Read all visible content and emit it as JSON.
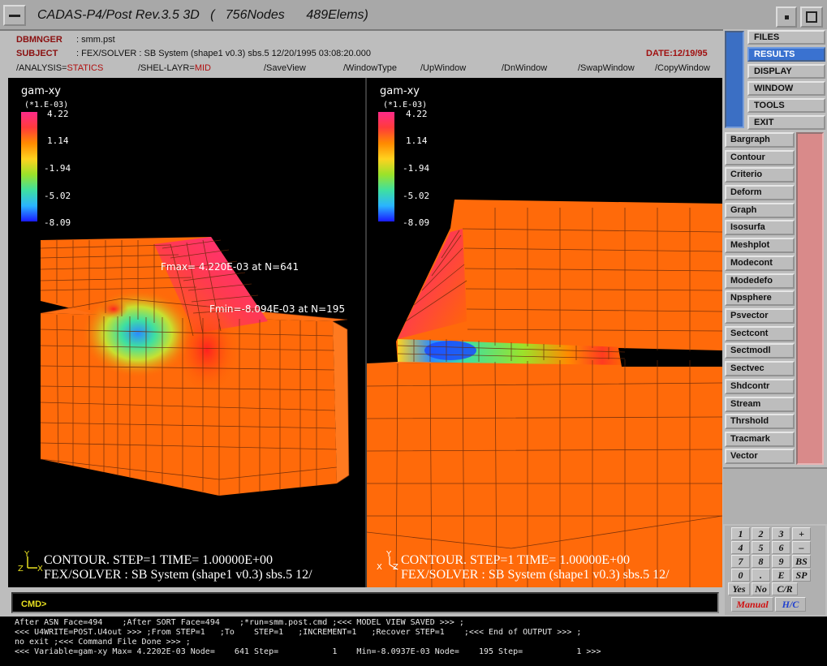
{
  "window": {
    "title": "CADAS-P4/Post Rev.3.5 3D   (   756Nodes      489Elems)"
  },
  "header": {
    "dbmnger_label": "DBMNGER",
    "dbmnger_value": ": smm.pst",
    "subject_label": "SUBJECT",
    "subject_value": ": FEX/SOLVER : SB System (shape1 v0.3) sbs.5 12/20/1995 03:08:20.000",
    "date": "DATE:12/19/95"
  },
  "toolbar": {
    "analysis_prefix": "/ANALYSIS=",
    "analysis_value": "STATICS",
    "shel_prefix": "/SHEL-LAYR=",
    "shel_value": "MID",
    "save_view": "/SaveView",
    "window_type": "/WindowType",
    "up_window": "/UpWindow",
    "dn_window": "/DnWindow",
    "swap_window": "/SwapWindow",
    "copy_window": "/CopyWindow"
  },
  "main_menu": {
    "items": [
      "FILES",
      "RESULTS",
      "DISPLAY",
      "WINDOW",
      "TOOLS",
      "EXIT"
    ],
    "active": "RESULTS"
  },
  "sub_menu": {
    "items": [
      "Bargraph",
      "Contour",
      "Criterio",
      "Deform",
      "Graph",
      "Isosurfa",
      "Meshplot",
      "Modecont",
      "Modedefo",
      "Npsphere",
      "Psvector",
      "Sectcont",
      "Sectmodl",
      "Sectvec",
      "Shdcontr",
      "Stream",
      "Thrshold",
      "Tracmark",
      "Vector"
    ]
  },
  "keypad": {
    "rows": [
      [
        "1",
        "2",
        "3",
        "+"
      ],
      [
        "4",
        "5",
        "6",
        "–"
      ],
      [
        "7",
        "8",
        "9",
        "BS"
      ],
      [
        "0",
        ".",
        "E",
        "SP"
      ],
      [
        "Yes",
        "No",
        "C/R"
      ]
    ],
    "manual": "Manual",
    "hc": "H/C"
  },
  "legend": {
    "title": "gam-xy",
    "scale": "(*1.E-03)",
    "ticks": [
      "4.22",
      "1.14",
      "-1.94",
      "-5.02",
      "-8.09"
    ],
    "colors": [
      "#ff2a8a",
      "#ff3b3b",
      "#ff8a00",
      "#ffd21f",
      "#9be22a",
      "#3fe0a0",
      "#2ab4ff",
      "#1a1aff"
    ]
  },
  "left_view": {
    "fmax": "Fmax= 4.220E-03 at N=641",
    "fmin": "Fmin=-8.094E-03 at N=195",
    "contour_line": "CONTOUR.  STEP=1   TIME= 1.00000E+00",
    "solver_line": "FEX/SOLVER : SB System (shape1 v0.3) sbs.5 12/",
    "axis_y": "Y",
    "axis_z": "Z",
    "axis_x": "X"
  },
  "right_view": {
    "contour_line": "CONTOUR.  STEP=1   TIME= 1.00000E+00",
    "solver_line": "FEX/SOLVER : SB System (shape1 v0.3) sbs.5 12/",
    "axis_y": "Y",
    "axis_z": "Z",
    "axis_x": "X"
  },
  "cmd": {
    "label": "CMD>"
  },
  "log": {
    "lines": [
      "After ASN Face=494    ;After SORT Face=494    ;*run=smm.post.cmd ;<<< MODEL VIEW SAVED >>> ;",
      "<<< U4WRITE=POST.U4out >>> ;From STEP=1   ;To    STEP=1   ;INCREMENT=1   ;Recover STEP=1    ;<<< End of OUTPUT >>> ;",
      "no exit ;<<< Command File Done >>> ;",
      "<<< Variable=gam-xy Max= 4.2202E-03 Node=    641 Step=           1    Min=-8.0937E-03 Node=    195 Step=           1 >>>"
    ]
  }
}
